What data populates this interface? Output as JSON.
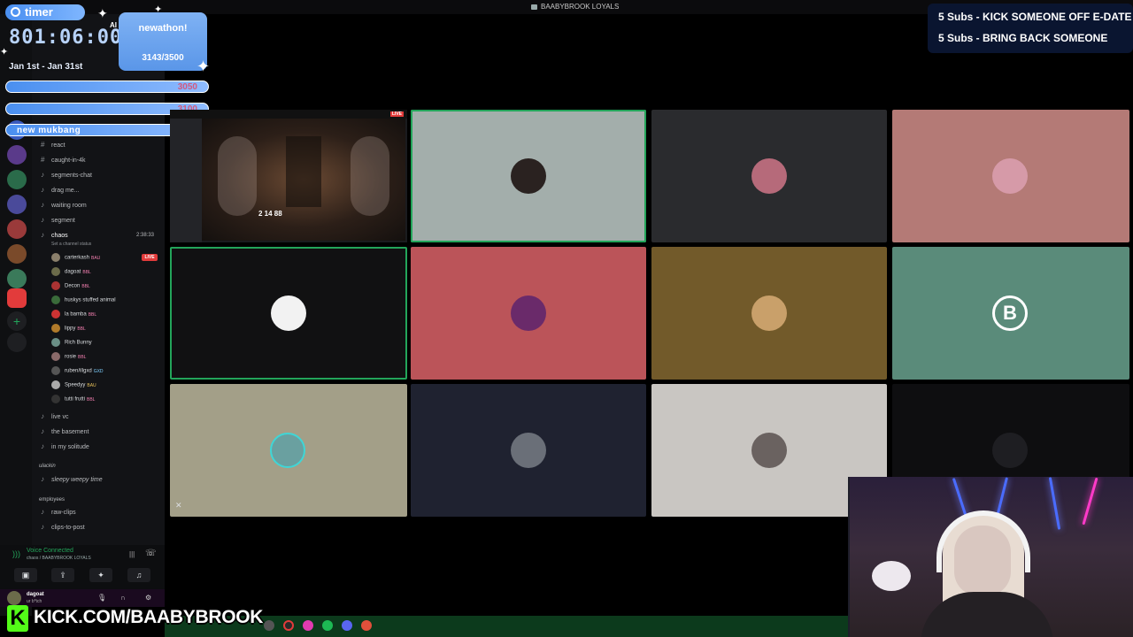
{
  "window": {
    "server_title": "BAABYBROOK LOYALS"
  },
  "overlay": {
    "timer_label": "timer",
    "timer_value": "801:06:00",
    "timer_suffix": "AI",
    "date_range": "Jan 1st - Jan 31st",
    "goal_title": "newathon!",
    "goal_progress": "3143/3500",
    "goals": [
      {
        "label": "",
        "value": "3050"
      },
      {
        "label": "",
        "value": "3100"
      },
      {
        "label": "new mukbang",
        "value": "3150"
      }
    ],
    "subs_rules": [
      "5 Subs - KICK SOMEONE OFF E-DATE",
      "5 Subs - BRING BACK SOMEONE"
    ],
    "kick_letter": "K",
    "kick_url": "KICK.COM/BAABYBROOK"
  },
  "channels": {
    "text": [
      "react",
      "caught-in-4k",
      "segments-chat",
      "drag me...",
      "waiting room",
      "segment"
    ],
    "active_voice": "chaos",
    "active_voice_time": "2:38:33",
    "set_status": "Set a channel status",
    "members": [
      {
        "name": "carterkash",
        "tag": "BAU",
        "color": "#8a7f6b",
        "live": "LIVE"
      },
      {
        "name": "dagoat",
        "tag": "BBL",
        "color": "#6b6b4a"
      },
      {
        "name": "Decon",
        "tag": "BBL",
        "color": "#a33"
      },
      {
        "name": "huskys stuffed animal",
        "tag": "",
        "color": "#3a6b3a"
      },
      {
        "name": "la bamba",
        "tag": "BBL",
        "color": "#c33"
      },
      {
        "name": "lippy",
        "tag": "BBL",
        "color": "#b07a2a"
      },
      {
        "name": "Rich Bunny",
        "tag": "",
        "color": "#6a8f86"
      },
      {
        "name": "rosie",
        "tag": "BBL",
        "color": "#8a6a6a"
      },
      {
        "name": "ruben/illgxd",
        "tag": "GXD",
        "color": "#555"
      },
      {
        "name": "Speedyy",
        "tag": "BAU",
        "color": "#aaa"
      },
      {
        "name": "tutti frutti",
        "tag": "BBL",
        "color": "#333"
      }
    ],
    "voice_more": [
      "live vc",
      "the basement",
      "in my solitude"
    ],
    "category_1": "ulackin",
    "sleepy": "sleepy weepy time",
    "category_2": "employees",
    "clips": [
      "raw-clips",
      "clips-to-post"
    ]
  },
  "voice_panel": {
    "status": "Voice Connected",
    "sub": "chaos / BAABYBROOK LOYALS",
    "user_name": "dagoat",
    "user_sub": "ur b*tch"
  },
  "screen_share": {
    "live": "LIVE",
    "hud": "2   14  88"
  },
  "tile_colors": {
    "t1": "#a3aeab",
    "t2": "#2a2b2e",
    "t3": "#b47a76",
    "t4": "#111112",
    "t5": "#bb5459",
    "t6": "#725a2a",
    "t7": "#5a8b7a",
    "t8": "#a39f88",
    "t9": "#1f2230",
    "t10": "#c9c6c2",
    "t11": "#0e0e10"
  },
  "icons": [
    "clock-icon",
    "sparkle-icon",
    "hash-icon",
    "speaker-icon",
    "mute-icon",
    "mic-icon",
    "headphones-icon",
    "gear-icon"
  ]
}
